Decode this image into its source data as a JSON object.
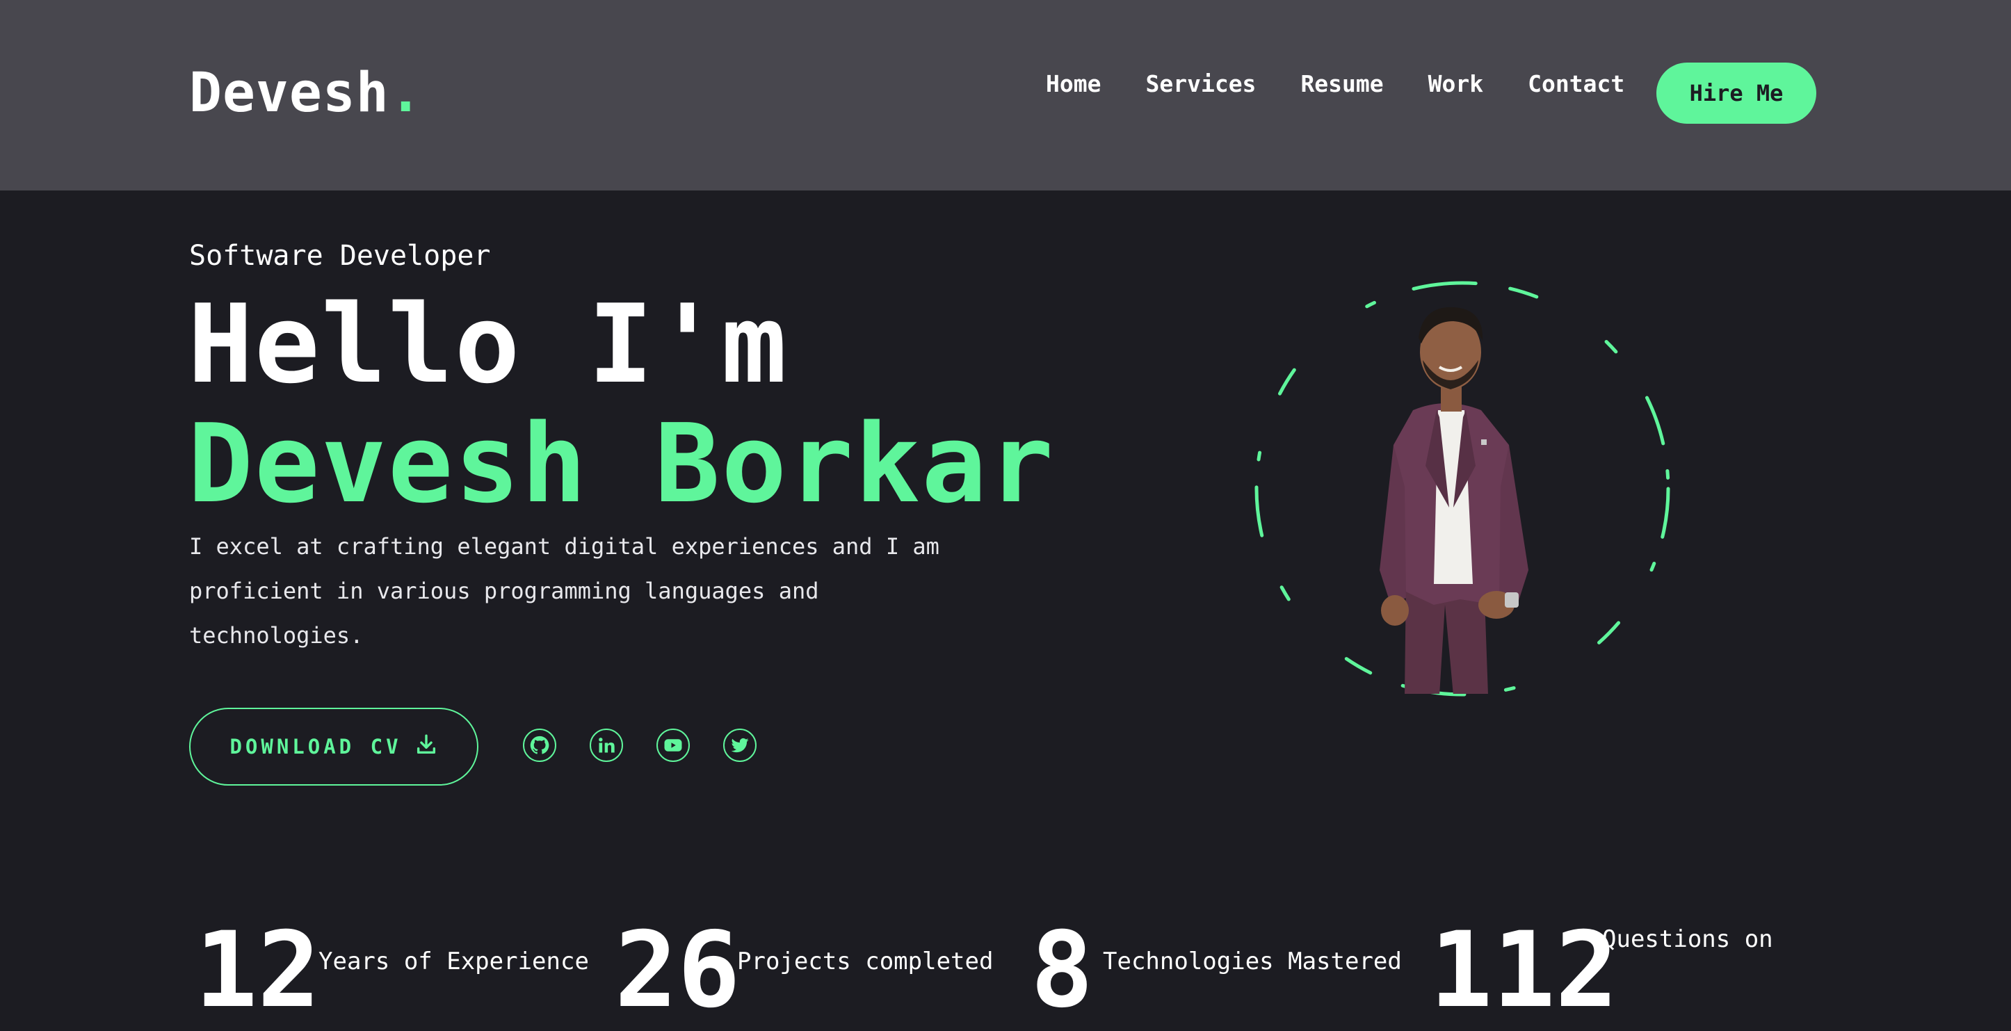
{
  "header": {
    "logo_text": "Devesh",
    "logo_dot": ".",
    "nav": [
      "Home",
      "Services",
      "Resume",
      "Work",
      "Contact"
    ],
    "hire_label": "Hire Me"
  },
  "hero": {
    "subtitle": "Software Developer",
    "greeting": "Hello I'm",
    "name": "Devesh Borkar",
    "description": "I excel at crafting elegant digital experiences and I am proficient in various programming languages and technologies.",
    "download_label": "DOWNLOAD CV",
    "socials": [
      "github-icon",
      "linkedin-icon",
      "youtube-icon",
      "twitter-icon"
    ]
  },
  "stats": [
    {
      "value": "12",
      "label": "Years of Experience"
    },
    {
      "value": "26",
      "label": "Projects completed"
    },
    {
      "value": "8",
      "label": "Technologies Mastered"
    },
    {
      "value": "112",
      "label": "Questions on"
    }
  ],
  "colors": {
    "accent": "#5ff59b",
    "background": "#1c1c22",
    "header": "#48474e"
  }
}
